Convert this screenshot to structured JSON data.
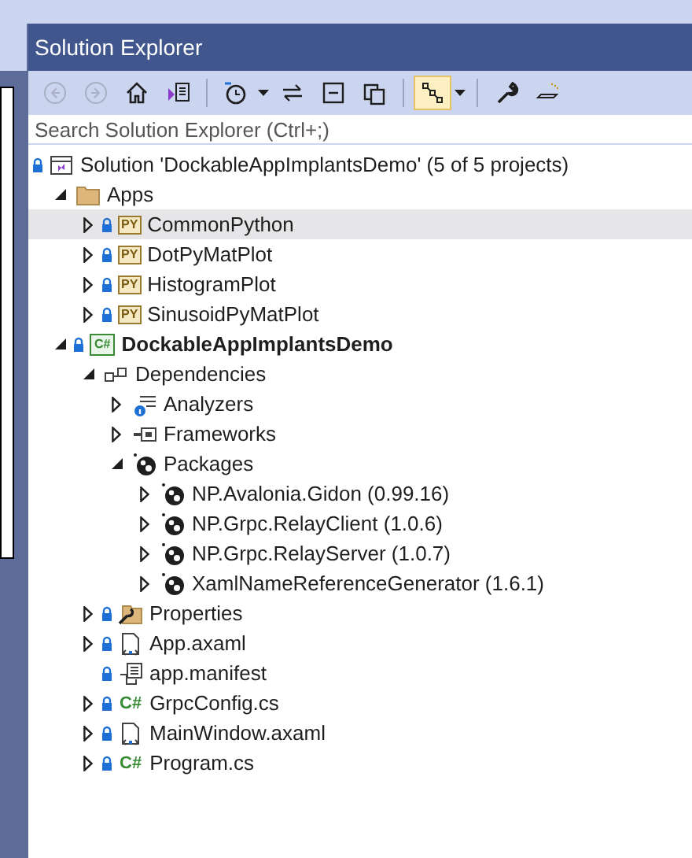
{
  "panel": {
    "title": "Solution Explorer"
  },
  "search": {
    "placeholder": "Search Solution Explorer (Ctrl+;)"
  },
  "toolbar": [
    {
      "kind": "back",
      "disabled": true
    },
    {
      "kind": "forward",
      "disabled": true
    },
    {
      "kind": "home",
      "disabled": false
    },
    {
      "kind": "switch-views",
      "disabled": false
    },
    {
      "kind": "separator"
    },
    {
      "kind": "pending-changes",
      "disabled": false,
      "dropdown": true
    },
    {
      "kind": "sync",
      "disabled": false
    },
    {
      "kind": "collapse",
      "disabled": false
    },
    {
      "kind": "show-all",
      "disabled": false
    },
    {
      "kind": "separator"
    },
    {
      "kind": "preview",
      "disabled": false,
      "on": true,
      "dropdown": true
    },
    {
      "kind": "separator"
    },
    {
      "kind": "properties",
      "disabled": false
    },
    {
      "kind": "preview-selected",
      "disabled": false
    }
  ],
  "tree": [
    {
      "label": "Solution 'DockableAppImplantsDemo' (5 of 5 projects)",
      "kind": "solution",
      "locked": true,
      "selected": false,
      "children": [
        {
          "label": "Apps",
          "kind": "folder",
          "locked": false,
          "expanded": true,
          "selected": false,
          "children": [
            {
              "label": "CommonPython",
              "kind": "python",
              "badge": "PY",
              "locked": true,
              "expanded": false,
              "selected": true
            },
            {
              "label": "DotPyMatPlot",
              "kind": "python",
              "badge": "PY",
              "locked": true,
              "expanded": false,
              "selected": false
            },
            {
              "label": "HistogramPlot",
              "kind": "python",
              "badge": "PY",
              "locked": true,
              "expanded": false,
              "selected": false
            },
            {
              "label": "SinusoidPyMatPlot",
              "kind": "python",
              "badge": "PY",
              "locked": true,
              "expanded": false,
              "selected": false
            }
          ]
        },
        {
          "label": "DockableAppImplantsDemo",
          "kind": "csproject",
          "badge": "C#",
          "locked": true,
          "expanded": true,
          "selected": false,
          "children": [
            {
              "label": "Dependencies",
              "kind": "dependencies",
              "locked": false,
              "expanded": true,
              "selected": false,
              "children": [
                {
                  "label": "Analyzers",
                  "kind": "analyzers",
                  "locked": false,
                  "expanded": false,
                  "selected": false
                },
                {
                  "label": "Frameworks",
                  "kind": "frameworks",
                  "locked": false,
                  "expanded": false,
                  "selected": false
                },
                {
                  "label": "Packages",
                  "kind": "packages",
                  "locked": false,
                  "expanded": true,
                  "selected": false,
                  "children": [
                    {
                      "label": "NP.Avalonia.Gidon (0.99.16)",
                      "kind": "package",
                      "locked": false,
                      "expanded": false,
                      "selected": false
                    },
                    {
                      "label": "NP.Grpc.RelayClient (1.0.6)",
                      "kind": "package",
                      "locked": false,
                      "expanded": false,
                      "selected": false
                    },
                    {
                      "label": "NP.Grpc.RelayServer (1.0.7)",
                      "kind": "package",
                      "locked": false,
                      "expanded": false,
                      "selected": false
                    },
                    {
                      "label": "XamlNameReferenceGenerator (1.6.1)",
                      "kind": "package",
                      "locked": false,
                      "expanded": false,
                      "selected": false
                    }
                  ]
                }
              ]
            },
            {
              "label": "Properties",
              "kind": "properties",
              "locked": true,
              "expanded": false,
              "selected": false
            },
            {
              "label": "App.axaml",
              "kind": "axaml",
              "locked": true,
              "expanded": false,
              "selected": false
            },
            {
              "label": "app.manifest",
              "kind": "manifest",
              "locked": true,
              "selected": false
            },
            {
              "label": "GrpcConfig.cs",
              "kind": "cs",
              "badge": "C#",
              "locked": true,
              "expanded": false,
              "selected": false
            },
            {
              "label": "MainWindow.axaml",
              "kind": "axaml",
              "locked": true,
              "expanded": false,
              "selected": false
            },
            {
              "label": "Program.cs",
              "kind": "cs",
              "badge": "C#",
              "locked": true,
              "expanded": false,
              "selected": false
            }
          ]
        }
      ]
    }
  ]
}
